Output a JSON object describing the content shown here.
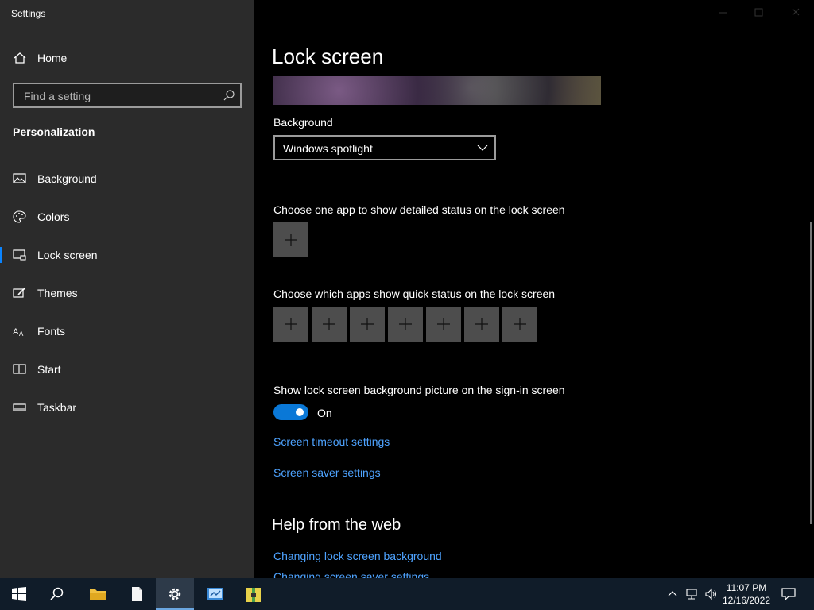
{
  "window": {
    "title": "Settings"
  },
  "sidebar": {
    "home_label": "Home",
    "search_placeholder": "Find a setting",
    "section": "Personalization",
    "items": [
      {
        "label": "Background",
        "icon": "picture-icon"
      },
      {
        "label": "Colors",
        "icon": "palette-icon"
      },
      {
        "label": "Lock screen",
        "icon": "lock-screen-icon",
        "selected": true
      },
      {
        "label": "Themes",
        "icon": "brush-icon"
      },
      {
        "label": "Fonts",
        "icon": "font-icon"
      },
      {
        "label": "Start",
        "icon": "start-grid-icon"
      },
      {
        "label": "Taskbar",
        "icon": "taskbar-icon"
      }
    ]
  },
  "main": {
    "title": "Lock screen",
    "background_label": "Background",
    "background_value": "Windows spotlight",
    "detailed_status_label": "Choose one app to show detailed status on the lock screen",
    "quick_status_label": "Choose which apps show quick status on the lock screen",
    "show_bg_label": "Show lock screen background picture on the sign-in screen",
    "toggle_state": "On",
    "link_timeout": "Screen timeout settings",
    "link_saver": "Screen saver settings",
    "help_title": "Help from the web",
    "help_links": [
      "Changing lock screen background",
      "Changing screen saver settings"
    ]
  },
  "taskbar": {
    "time": "11:07 PM",
    "date": "12/16/2022",
    "icons": [
      "start-icon",
      "search-icon",
      "file-explorer-icon",
      "notepad-icon",
      "settings-icon",
      "control-panel-icon",
      "archive-icon"
    ]
  },
  "colors": {
    "accent": "#0a78d7",
    "link": "#4ea3ff",
    "sidebar": "#2b2b2b",
    "taskbar": "#101c29"
  }
}
